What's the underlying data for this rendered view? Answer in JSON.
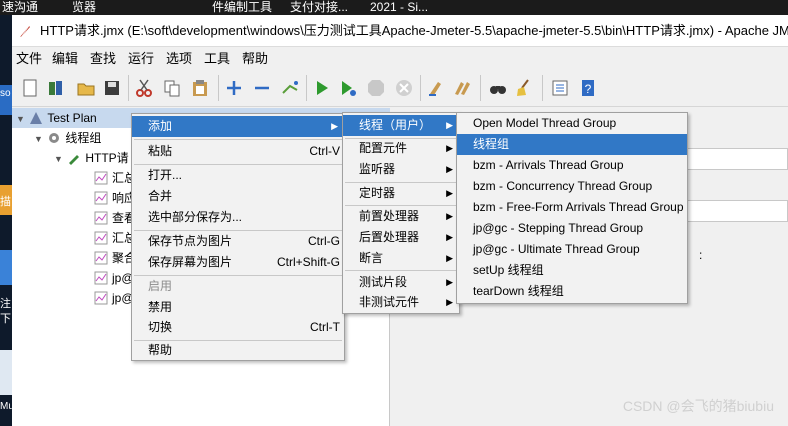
{
  "taskbar": {
    "items": [
      "速沟通",
      "览器",
      "件编制工具",
      "支付对接...",
      "2021 - Si..."
    ]
  },
  "window": {
    "title": "HTTP请求.jmx (E:\\soft\\development\\windows\\压力测试工具Apache-Jmeter-5.5\\apache-jmeter-5.5\\bin\\HTTP请求.jmx) - Apache JMe"
  },
  "menubar": [
    "文件",
    "编辑",
    "查找",
    "运行",
    "选项",
    "工具",
    "帮助"
  ],
  "desktop_labels": {
    "a": "so",
    "b": "描",
    "c": "注",
    "d": "下",
    "e": "Mu"
  },
  "tree": {
    "test_plan": "Test Plan",
    "thread_group": "线程组",
    "http_request": "HTTP请",
    "children": [
      "汇总",
      "响应",
      "查看",
      "汇总",
      "聚合",
      "jp@",
      "jp@"
    ]
  },
  "right_panel": {
    "colon": ":"
  },
  "context_menu": {
    "items": [
      {
        "label": "添加",
        "shortcut": "",
        "submenu": true,
        "highlighted": true,
        "disabled": false
      },
      {
        "label": "粘贴",
        "shortcut": "Ctrl-V",
        "submenu": false,
        "highlighted": false,
        "disabled": false
      },
      {
        "label": "打开...",
        "shortcut": "",
        "submenu": false,
        "highlighted": false,
        "disabled": false
      },
      {
        "label": "合并",
        "shortcut": "",
        "submenu": false,
        "highlighted": false,
        "disabled": false
      },
      {
        "label": "选中部分保存为...",
        "shortcut": "",
        "submenu": false,
        "highlighted": false,
        "disabled": false
      },
      {
        "label": "保存节点为图片",
        "shortcut": "Ctrl-G",
        "submenu": false,
        "highlighted": false,
        "disabled": false
      },
      {
        "label": "保存屏幕为图片",
        "shortcut": "Ctrl+Shift-G",
        "submenu": false,
        "highlighted": false,
        "disabled": false
      },
      {
        "label": "启用",
        "shortcut": "",
        "submenu": false,
        "highlighted": false,
        "disabled": true
      },
      {
        "label": "禁用",
        "shortcut": "",
        "submenu": false,
        "highlighted": false,
        "disabled": false
      },
      {
        "label": "切换",
        "shortcut": "Ctrl-T",
        "submenu": false,
        "highlighted": false,
        "disabled": false
      },
      {
        "label": "帮助",
        "shortcut": "",
        "submenu": false,
        "highlighted": false,
        "disabled": false
      }
    ]
  },
  "add_submenu": {
    "items": [
      {
        "label": "线程（用户）",
        "highlighted": true
      },
      {
        "label": "配置元件",
        "highlighted": false
      },
      {
        "label": "监听器",
        "highlighted": false
      },
      {
        "label": "定时器",
        "highlighted": false
      },
      {
        "label": "前置处理器",
        "highlighted": false
      },
      {
        "label": "后置处理器",
        "highlighted": false
      },
      {
        "label": "断言",
        "highlighted": false
      },
      {
        "label": "测试片段",
        "highlighted": false
      },
      {
        "label": "非测试元件",
        "highlighted": false
      }
    ]
  },
  "thread_submenu": {
    "items": [
      {
        "label": "Open Model Thread Group",
        "highlighted": false
      },
      {
        "label": "线程组",
        "highlighted": true
      },
      {
        "label": "bzm - Arrivals Thread Group",
        "highlighted": false
      },
      {
        "label": "bzm - Concurrency Thread Group",
        "highlighted": false
      },
      {
        "label": "bzm - Free-Form Arrivals Thread Group",
        "highlighted": false
      },
      {
        "label": "jp@gc - Stepping Thread Group",
        "highlighted": false
      },
      {
        "label": "jp@gc - Ultimate Thread Group",
        "highlighted": false
      },
      {
        "label": "setUp 线程组",
        "highlighted": false
      },
      {
        "label": "tearDown 线程组",
        "highlighted": false
      }
    ]
  },
  "watermark": "CSDN @会飞的猪biubiu",
  "colors": {
    "highlight": "#3178c6",
    "tree_selection": "#c7d9ee"
  }
}
